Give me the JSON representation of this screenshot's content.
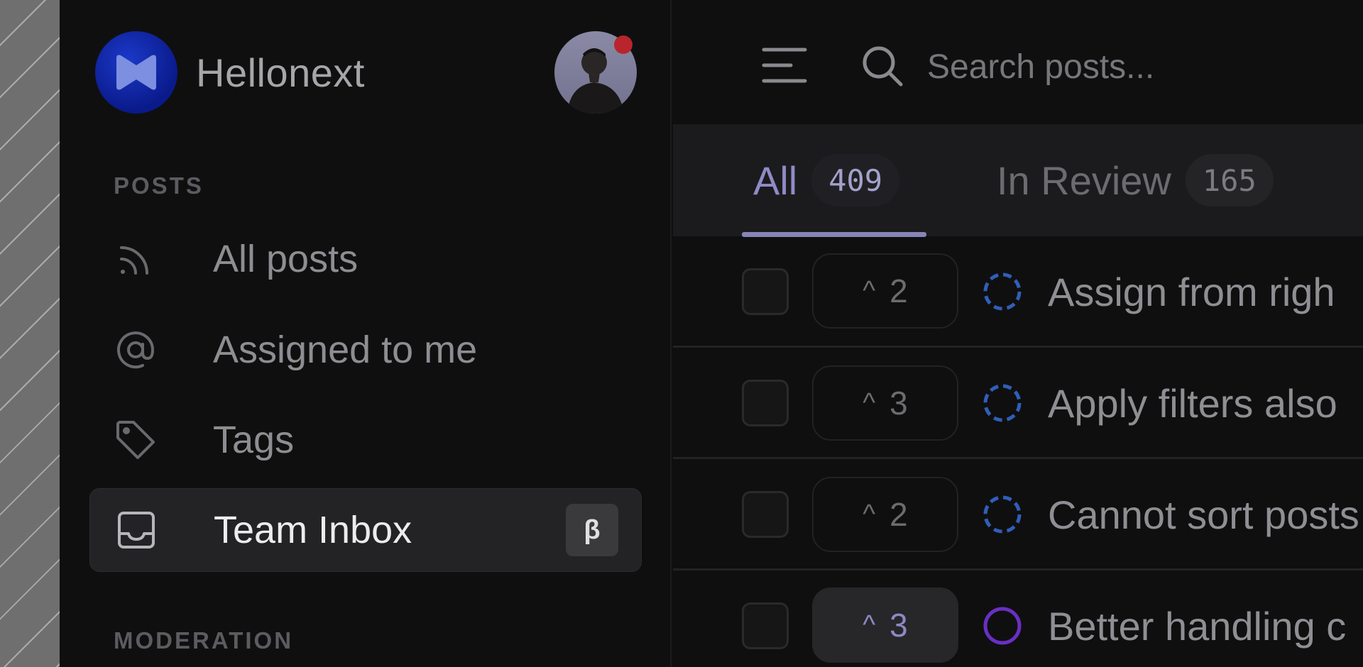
{
  "brand": {
    "name": "Hellonext"
  },
  "sidebar": {
    "sections": [
      {
        "label": "POSTS"
      },
      {
        "label": "MODERATION"
      }
    ],
    "items": [
      {
        "label": "All posts",
        "icon": "rss-icon"
      },
      {
        "label": "Assigned to me",
        "icon": "at-icon"
      },
      {
        "label": "Tags",
        "icon": "tag-icon"
      },
      {
        "label": "Team Inbox",
        "icon": "inbox-icon",
        "badge": "β",
        "active": true
      }
    ]
  },
  "search": {
    "placeholder": "Search posts..."
  },
  "tabs": [
    {
      "label": "All",
      "count": "409",
      "active": true
    },
    {
      "label": "In Review",
      "count": "165"
    }
  ],
  "posts": [
    {
      "votes": "2",
      "title": "Assign from righ",
      "status": "in-review",
      "voted": false
    },
    {
      "votes": "3",
      "title": "Apply filters also",
      "status": "in-review",
      "voted": false
    },
    {
      "votes": "2",
      "title": "Cannot sort posts",
      "status": "in-review",
      "voted": false
    },
    {
      "votes": "3",
      "title": "Better handling c",
      "status": "planned",
      "voted": true
    }
  ],
  "colors": {
    "accent": "#8784b8",
    "logo": "#0a1a8a",
    "status_in_review": "#2f5fb8",
    "status_planned": "#6a2fc4",
    "notification": "#b8252c"
  }
}
